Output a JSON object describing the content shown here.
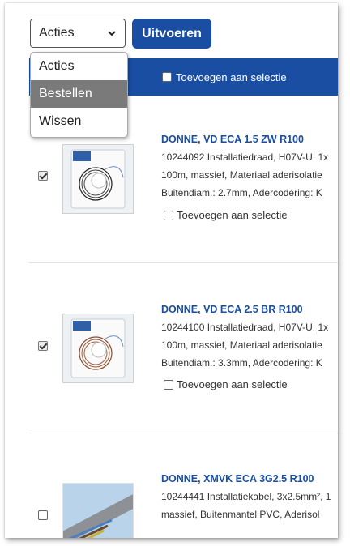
{
  "toolbar": {
    "select_value": "Acties",
    "run_label": "Uitvoeren"
  },
  "dropdown": {
    "options": [
      "Acties",
      "Bestellen",
      "Wissen"
    ],
    "highlighted": "Bestellen"
  },
  "header": {
    "select_all_label": "Toevoegen aan selectie"
  },
  "products": [
    {
      "title": "DONNE, VD ECA 1.5 ZW R100",
      "lines": [
        "10244092 Installatiedraad, H07V-U, 1x",
        "100m, massief, Materiaal aderisolatie",
        "Buitendiam.: 2.7mm, Adercodering: K"
      ],
      "select_label": "Toevoegen aan selectie",
      "checked": true
    },
    {
      "title": "DONNE, VD ECA 2.5 BR R100",
      "lines": [
        "10244100 Installatiedraad, H07V-U, 1x",
        "100m, massief, Materiaal aderisolatie",
        "Buitendiam.: 3.3mm, Adercodering: K"
      ],
      "select_label": "Toevoegen aan selectie",
      "checked": true
    },
    {
      "title": "DONNE, XMVK ECA 3G2.5 R100",
      "lines": [
        "10244441 Installatiekabel, 3x2.5mm², 1",
        "massief, Buitenmantel PVC, Aderisol"
      ],
      "checked": false
    }
  ],
  "colors": {
    "accent": "#1a4ea3",
    "dropdown_highlight": "#7a7a7a"
  }
}
